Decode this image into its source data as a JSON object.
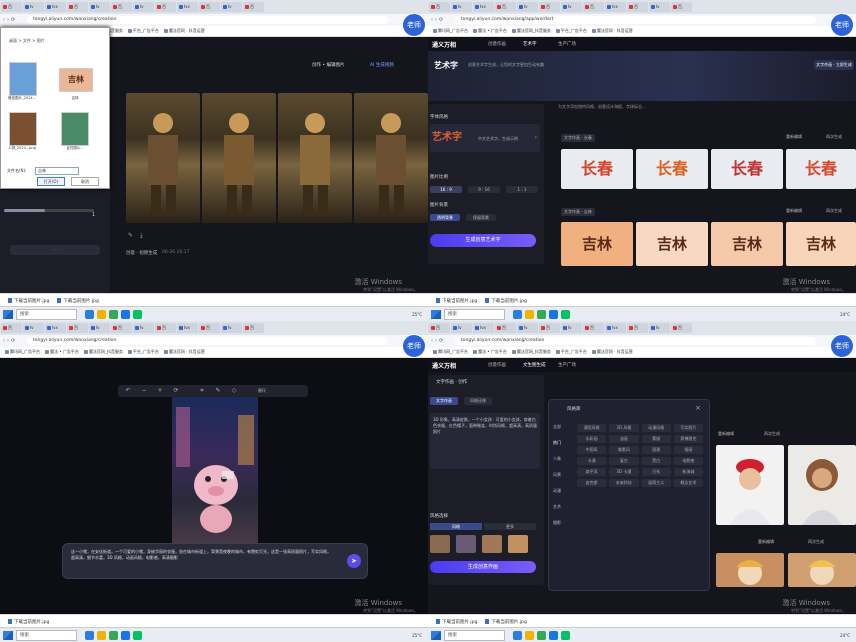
{
  "teacher_badge": "老师",
  "watermark": {
    "line1": "激活 Windows",
    "line2": "转到\"设置\"以激活 Windows。"
  },
  "taskbar": {
    "search": "搜索",
    "temp": "25°C",
    "temp2": "24°C"
  },
  "bookmarks": [
    "腾讯网_广告平台",
    "魔法 • 广告平台",
    "魔法官网_抖音服务",
    "平台_广告平台",
    "魔法官网 · 抖音运营",
    "..."
  ],
  "tabs": [
    "百",
    "百",
    "百",
    "Iv",
    "Ivx",
    "Iv",
    "百",
    "Iv",
    "Iv",
    "百",
    "Ivx",
    "Iv",
    "百",
    "百",
    "Iv",
    "百",
    "百",
    "百",
    "百",
    "百",
    "百"
  ],
  "q1": {
    "url": "tongyi.aliyun.com/wanxiang/creation",
    "file_dialog": {
      "path": "桌面 > 文件 > 图片",
      "files": [
        {
          "name": "微信图片_2024...",
          "color": "#6aa0d8"
        },
        {
          "name": "吉林",
          "color": "#e8b898",
          "text": "吉林"
        },
        {
          "name": "人物_2024...png",
          "color": "#7a5030"
        },
        {
          "name": "证件照片...",
          "color": "#4a8c68"
        }
      ],
      "filename_label": "文件名(N):",
      "filename_value": "吉林",
      "open": "打开(O)",
      "cancel": "取消"
    },
    "toolbar": {
      "edit": "创作 • 编辑图片",
      "generate": "AI 生成视频"
    },
    "slider_value": "1",
    "footer_left": "创意 · 视频生成",
    "footer_time": "06-26 16:17",
    "download": "下载当前图片.jpg"
  },
  "q2": {
    "url": "tongyi.aliyun.com/wanxiang/app/wordart",
    "brand": "通义万相",
    "nav": [
      "创意作画",
      "艺术字",
      "生产广场"
    ],
    "create_btn": "文字作画 · 立即生成",
    "page_title": "艺术字",
    "page_subtitle": "创意艺术字生成，让您的文字更加生动有趣",
    "ribbon": "为文字添加独特风格，创意设计海报、字体标志...",
    "section_font": "字体风格",
    "font_preview": "艺术字",
    "font_hint": "中文艺术字，生成示例",
    "section_ratio": "图片比例",
    "ratios": [
      "16 : 9",
      "1 : 1",
      "9 : 16"
    ],
    "section_bg": "图片背景",
    "bg_opts": [
      "透明背景",
      "保留背景"
    ],
    "generate": "生成创意艺术字",
    "row1_tag": "文字作画 · 长春",
    "row1_actions": [
      "重新编辑",
      "再次生成"
    ],
    "row1_text": "长春",
    "row2_tag": "文字作画 · 吉林",
    "row2_actions": [
      "重新编辑",
      "再次生成"
    ],
    "row2_text": "吉林",
    "download": "下载当前图片.jpg"
  },
  "q3": {
    "url": "tongyi.aliyun.com/wanxiang/creation",
    "prompt": "这一小猪，在安化街道，一个可爱的小猪，身披华丽的衣服，坐在城市街道上，背景是夜晚的城市，有霓虹灯光，这是一张高质量照片，写实风格，超高清，细节丰富，3D 风格，动画风格，电影感，高清摄影",
    "size_label": "原尺",
    "download": "下载当前图片.jpg"
  },
  "q4": {
    "url": "tongyi.aliyun.com/wanxiang/creation",
    "brand": "通义万相",
    "nav": [
      "创意作画",
      "文生图生成",
      "生产广场"
    ],
    "panel_title": "文字作画 · 创作",
    "modes": [
      "文字作画",
      "风格迁移"
    ],
    "prompt": "3D 形象，高清皮肤，一个小女孩 · 可爱的小女孩，穿着白色衣服，红色帽子，面带微笑，时尚风格，超高清，高质量照片",
    "style_section": "风格选择",
    "style_tabs": [
      "风格",
      "更多"
    ],
    "generate": "生成创意作画",
    "dialog_title": "风格库",
    "dialog_cats": [
      "全部",
      "热门",
      "人像",
      "风景",
      "动漫",
      "艺术",
      "摄影"
    ],
    "styles": [
      "通用风格",
      "3D 风格",
      "动漫风格",
      "写实照片",
      "水彩画",
      "油画",
      "素描",
      "赛博朋克",
      "中国风",
      "像素风",
      "国潮",
      "插画",
      "卡通",
      "复古",
      "黑白",
      "电影感",
      "扁平风",
      "3D 卡通",
      "日系",
      "新海诚",
      "皮克斯",
      "未来科技",
      "极简主义",
      "概念艺术"
    ],
    "results_tag": "文字作画 · 女孩",
    "actions": [
      "重新编辑",
      "再次生成"
    ],
    "download": "下载当前图片.jpg"
  }
}
